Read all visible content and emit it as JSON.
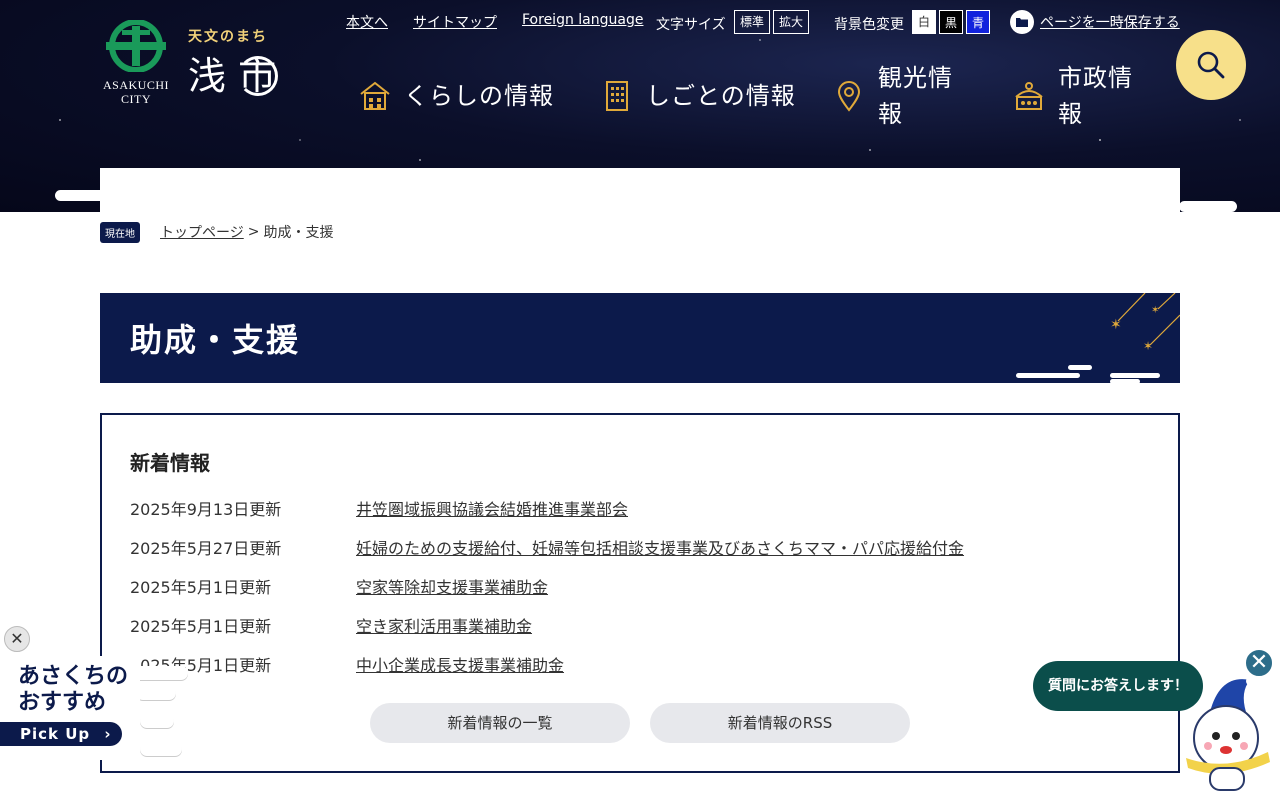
{
  "header": {
    "logo": {
      "tagline": "天文のまち",
      "city_name": "浅 市",
      "city_roman_1": "ASAKUCHI",
      "city_roman_2": "CITY"
    },
    "utility": {
      "skip_link": "本文へ",
      "sitemap": "サイトマップ",
      "foreign": "Foreign language",
      "text_size_label": "文字サイズ",
      "text_size_standard": "標準",
      "text_size_large": "拡大",
      "bg_color_label": "背景色変更",
      "bg_white": "白",
      "bg_black": "黒",
      "bg_blue": "青",
      "save_page": "ページを一時保存する"
    },
    "nav": [
      {
        "label": "くらしの情報",
        "icon": "house-icon"
      },
      {
        "label": "しごとの情報",
        "icon": "building-icon"
      },
      {
        "label": "観光情報",
        "icon": "map-pin-icon"
      },
      {
        "label": "市政情報",
        "icon": "city-hall-icon"
      }
    ],
    "search_icon": "search-icon"
  },
  "breadcrumb": {
    "current_label": "現在地",
    "home": "トップページ",
    "separator": ">",
    "current": "助成・支援"
  },
  "page_title": "助成・支援",
  "news": {
    "heading": "新着情報",
    "items": [
      {
        "date": "2025年9月13日更新",
        "title": "井笠圏域振興協議会結婚推進事業部会"
      },
      {
        "date": "2025年5月27日更新",
        "title": "妊婦のための支援給付、妊婦等包括相談支援事業及びあさくちママ・パパ応援給付金"
      },
      {
        "date": "2025年5月1日更新",
        "title": "空家等除却支援事業補助金"
      },
      {
        "date": "2025年5月1日更新",
        "title": "空き家利活用事業補助金"
      },
      {
        "date": "2025年5月1日更新",
        "title": "中小企業成長支援事業補助金"
      }
    ],
    "list_button": "新着情報の一覧",
    "rss_button": "新着情報のRSS"
  },
  "pickup": {
    "close": "✕",
    "line1": "あさくちの",
    "line2": "おすすめ",
    "label": "Pick Up",
    "arrow": "›"
  },
  "chatbot": {
    "bubble": "質問にお答えします！",
    "close": "✕"
  },
  "colors": {
    "navy": "#0c1a4b",
    "search_yellow": "#f7e08a",
    "chat_green": "#0b4e4b",
    "gold": "#e0a93a"
  }
}
